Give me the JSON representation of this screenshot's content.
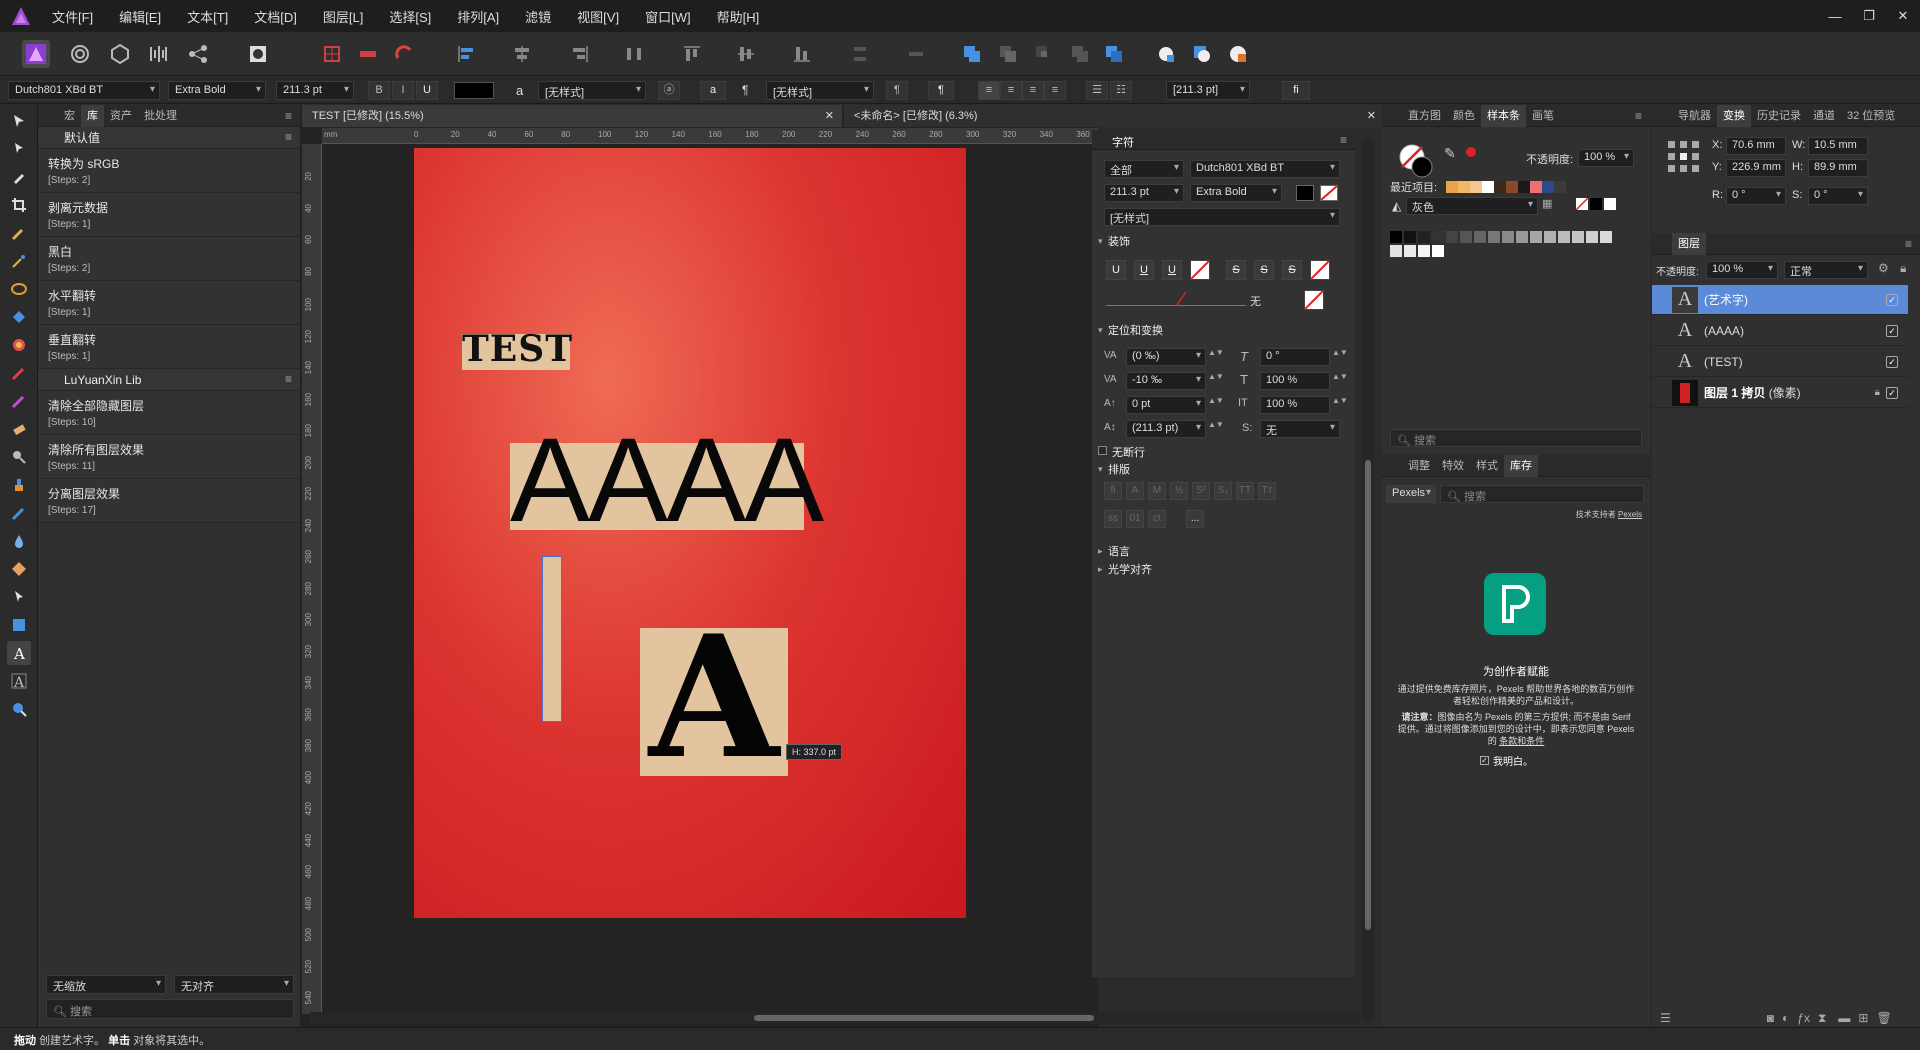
{
  "menu": {
    "items": [
      "文件[F]",
      "编辑[E]",
      "文本[T]",
      "文档[D]",
      "图层[L]",
      "选择[S]",
      "排列[A]",
      "滤镜",
      "视图[V]",
      "窗口[W]",
      "帮助[H]"
    ]
  },
  "context": {
    "font": "Dutch801 XBd BT",
    "weight": "Extra Bold",
    "size": "211.3 pt",
    "style1": "[无样式]",
    "style2": "[无样式]",
    "size2": "[211.3 pt]",
    "char_a": "a",
    "pilcrow": "¶",
    "lig": "fi"
  },
  "left_panel": {
    "tabs": [
      "宏",
      "库",
      "资产",
      "批处理"
    ],
    "group1": "默认值",
    "macros1": [
      {
        "title": "转换为 sRGB",
        "steps": "[Steps: 2]"
      },
      {
        "title": "剥离元数据",
        "steps": "[Steps: 1]"
      },
      {
        "title": "黑白",
        "steps": "[Steps: 2]"
      },
      {
        "title": "水平翻转",
        "steps": "[Steps: 1]"
      },
      {
        "title": "垂直翻转",
        "steps": "[Steps: 1]"
      }
    ],
    "group2": "LuYuanXin Lib",
    "macros2": [
      {
        "title": "清除全部隐藏图层",
        "steps": "[Steps: 10]"
      },
      {
        "title": "清除所有图层效果",
        "steps": "[Steps: 11]"
      },
      {
        "title": "分离图层效果",
        "steps": "[Steps: 17]"
      }
    ],
    "bottom_left": "无缩放",
    "bottom_right": "无对齐",
    "search_placeholder": "搜索"
  },
  "documents": {
    "tab1": "TEST [已修改] (15.5%)",
    "tab2": "<未命名> [已修改] (6.3%)"
  },
  "ruler": {
    "h": [
      "mm",
      "0",
      "20",
      "40",
      "60",
      "80",
      "100",
      "120",
      "140",
      "160",
      "180",
      "200",
      "220",
      "240",
      "260",
      "280",
      "300",
      "320",
      "340",
      "360"
    ],
    "v": [
      "20",
      "40",
      "60",
      "80",
      "100",
      "120",
      "140",
      "160",
      "180",
      "200",
      "220",
      "240",
      "260",
      "280",
      "300",
      "320",
      "340",
      "360",
      "380",
      "400",
      "420",
      "440",
      "460",
      "480",
      "500",
      "520",
      "540"
    ]
  },
  "canvas": {
    "text_test": "TEST",
    "text_aaaa": "AAAA",
    "text_a": "A",
    "tooltip": "H: 337.0 pt"
  },
  "character": {
    "title": "字符",
    "scope": "全部",
    "font": "Dutch801 XBd BT",
    "size": "211.3 pt",
    "weight": "Extra Bold",
    "style": "[无样式]",
    "sec_decor": "装饰",
    "line_none": "无",
    "sec_pos": "定位和变换",
    "kern": "(0 ‰)",
    "track": "-10 ‰",
    "baseline": "0 pt",
    "lead": "(211.3 pt)",
    "skew": "0 °",
    "vscale": "100 %",
    "hscale": "100 %",
    "s_label": "S:",
    "s_value": "无",
    "nobreak": "无断行",
    "sec_type": "排版",
    "more": "...",
    "sec_lang": "语言",
    "sec_optical": "光学对齐"
  },
  "mid_panel": {
    "tabs": [
      "直方图",
      "颜色",
      "样本条",
      "画笔"
    ],
    "opacity_label": "不透明度:",
    "opacity": "100 %",
    "recent": "最近项目:",
    "palette": "灰色",
    "search_placeholder": "搜索",
    "tabs2": [
      "调整",
      "特效",
      "样式",
      "库存"
    ],
    "pexels": "Pexels",
    "stock_search": "搜索",
    "powered": "技术支持者",
    "powered_link": "Pexels",
    "headline": "为创作者赋能",
    "desc": "通过提供免费库存照片，Pexels 帮助世界各地的数百万创作者轻松创作精美的产品和设计。",
    "note_bold": "请注意：",
    "note": "图像由名为 Pexels 的第三方提供; 而不是由 Serif 提供。通过将图像添加到您的设计中，即表示您同意 Pexels 的",
    "note_link": "条款和条件",
    "agree": "我明白。",
    "recent_colors": [
      "#e8a44a",
      "#f0b860",
      "#f2c890",
      "#ffffff",
      "#3a2a1a",
      "#8a4a2a",
      "#1a1a1a",
      "#f07070",
      "#2a4a8a",
      "#3a3a3a"
    ]
  },
  "right_panel": {
    "tabs": [
      "导航器",
      "变换",
      "历史记录",
      "通道",
      "32 位预览"
    ],
    "x": "70.6 mm",
    "w": "10.5 mm",
    "y": "226.9 mm",
    "h": "89.9 mm",
    "r": "0 °",
    "s": "0 °",
    "layers_title": "图层",
    "opacity_label": "不透明度:",
    "opacity": "100 %",
    "blend": "正常",
    "layers": [
      {
        "name": "(艺术字)",
        "sel": true
      },
      {
        "name": "(AAAA)",
        "sel": false
      },
      {
        "name": "(TEST)",
        "sel": false
      },
      {
        "name": "图层 1 拷贝",
        "suffix": "(像素)",
        "sel": false
      }
    ]
  },
  "status": {
    "b1": "拖动",
    "t1": "创建艺术字。",
    "b2": "单击",
    "t2": "对象将其选中。"
  }
}
